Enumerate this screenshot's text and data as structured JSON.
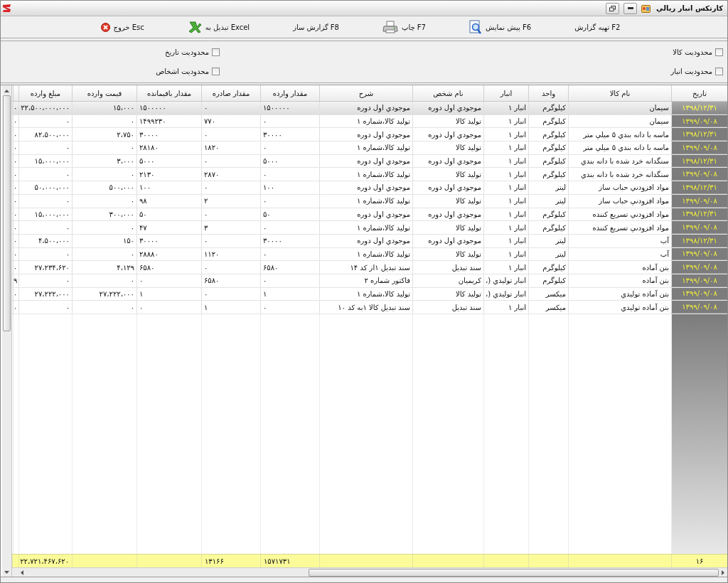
{
  "window": {
    "title": "کارتکس انبار ریالي"
  },
  "toolbar": [
    {
      "label": "تهیه گزارش  F2",
      "kind": "plain"
    },
    {
      "label": "پیش نمایش F6",
      "kind": "preview"
    },
    {
      "label": "چاپ F7",
      "kind": "print"
    },
    {
      "label": "گزارش ساز F8",
      "kind": "plain"
    },
    {
      "label": "تبدیل به Excel",
      "kind": "excel"
    },
    {
      "label": "خروج Esc",
      "kind": "exit"
    }
  ],
  "filters": [
    {
      "label": "محدودیت کالا",
      "checked": false
    },
    {
      "label": "محدودیت انبار",
      "checked": false
    },
    {
      "label": "محدودیت تاریخ",
      "checked": false
    },
    {
      "label": "محدودیت اشخاص",
      "checked": false
    }
  ],
  "table": {
    "columns": [
      "تاریخ",
      "نام کالا",
      "واحد",
      "انبار",
      "نام شخص",
      "شرح",
      "مقدار وارده",
      "مقدار صادره",
      "مقدار باقیمانده",
      "قیمت وارده",
      "مبلغ وارده"
    ],
    "rows": [
      {
        "selected": true,
        "cells": [
          "۱۳۹۸/۱۲/۳۱",
          "سیمان",
          "کیلوگرم",
          "انبار ۱",
          "موجودي اول دوره",
          "موجودي اول دوره",
          "۱۵۰۰۰۰۰",
          "۰",
          "۱۵۰۰۰۰۰",
          "۱۵،۰۰۰",
          "۲۲،۵۰۰،۰۰۰،۰۰۰",
          "۰"
        ]
      },
      {
        "selected": false,
        "cells": [
          "۱۳۹۹/۰۹/۰۸",
          "سیمان",
          "کیلوگرم",
          "انبار ۱",
          "تولید کالا",
          "تولید کالا،شماره ۱",
          "۰",
          "۷۷۰",
          "۱۴۹۹۲۳۰",
          "۰",
          "۰",
          "۰"
        ]
      },
      {
        "selected": false,
        "cells": [
          "۱۳۹۸/۱۲/۳۱",
          "ماسه با دانه بندي ۵ میلي متر",
          "کیلوگرم",
          "انبار ۱",
          "موجودي اول دوره",
          "موجودي اول دوره",
          "۳۰۰۰۰",
          "۰",
          "۳۰۰۰۰",
          "۲،۷۵۰",
          "۸۲،۵۰۰،۰۰۰",
          "۰"
        ]
      },
      {
        "selected": false,
        "cells": [
          "۱۳۹۹/۰۹/۰۸",
          "ماسه با دانه بندي ۵ میلي متر",
          "کیلوگرم",
          "انبار ۱",
          "تولید کالا",
          "تولید کالا،شماره ۱",
          "۰",
          "۱۸۲۰",
          "۲۸۱۸۰",
          "۰",
          "۰",
          "۰"
        ]
      },
      {
        "selected": false,
        "cells": [
          "۱۳۹۸/۱۲/۳۱",
          "سنگدانه خرد شده با دانه بندي",
          "کیلوگرم",
          "انبار ۱",
          "موجودي اول دوره",
          "موجودي اول دوره",
          "۵۰۰۰",
          "۰",
          "۵۰۰۰",
          "۳،۰۰۰",
          "۱۵،۰۰۰،۰۰۰",
          "۰"
        ]
      },
      {
        "selected": false,
        "cells": [
          "۱۳۹۹/۰۹/۰۸",
          "سنگدانه خرد شده با دانه بندي",
          "کیلوگرم",
          "انبار ۱",
          "تولید کالا",
          "تولید کالا،شماره ۱",
          "۰",
          "۲۸۷۰",
          "۲۱۳۰",
          "۰",
          "۰",
          "۰"
        ]
      },
      {
        "selected": false,
        "cells": [
          "۱۳۹۸/۱۲/۳۱",
          "مواد افزودني حباب ساز",
          "لیتر",
          "انبار ۱",
          "موجودي اول دوره",
          "موجودي اول دوره",
          "۱۰۰",
          "۰",
          "۱۰۰",
          "۵۰۰،۰۰۰",
          "۵۰،۰۰۰،۰۰۰",
          "۰"
        ]
      },
      {
        "selected": false,
        "cells": [
          "۱۳۹۹/۰۹/۰۸",
          "مواد افزودني حباب ساز",
          "لیتر",
          "انبار ۱",
          "تولید کالا",
          "تولید کالا،شماره ۱",
          "۰",
          "۲",
          "۹۸",
          "۰",
          "۰",
          "۰"
        ]
      },
      {
        "selected": false,
        "cells": [
          "۱۳۹۸/۱۲/۳۱",
          "مواد افزودني تسریع کننده",
          "کیلوگرم",
          "انبار ۱",
          "موجودي اول دوره",
          "موجودي اول دوره",
          "۵۰",
          "۰",
          "۵۰",
          "۳۰۰،۰۰۰",
          "۱۵،۰۰۰،۰۰۰",
          "۰"
        ]
      },
      {
        "selected": false,
        "cells": [
          "۱۳۹۹/۰۹/۰۸",
          "مواد افزودني تسریع کننده",
          "کیلوگرم",
          "انبار ۱",
          "تولید کالا",
          "تولید کالا،شماره ۱",
          "۰",
          "۳",
          "۴۷",
          "۰",
          "۰",
          "۰"
        ]
      },
      {
        "selected": false,
        "cells": [
          "۱۳۹۸/۱۲/۳۱",
          "آب",
          "لیتر",
          "انبار ۱",
          "موجودي اول دوره",
          "موجودي اول دوره",
          "۳۰۰۰۰",
          "۰",
          "۳۰۰۰۰",
          "۱۵۰",
          "۴،۵۰۰،۰۰۰",
          "۰"
        ]
      },
      {
        "selected": false,
        "cells": [
          "۱۳۹۹/۰۹/۰۸",
          "آب",
          "لیتر",
          "انبار ۱",
          "تولید کالا",
          "تولید کالا،شماره ۱",
          "۰",
          "۱۱۲۰",
          "۲۸۸۸۰",
          "۰",
          "۰",
          "۰"
        ]
      },
      {
        "selected": false,
        "cells": [
          "۱۳۹۹/۰۹/۰۸",
          "بتن آماده",
          "کیلوگرم",
          "انبار ۱",
          "سند تبدیل",
          "سند تبدیل ۱از کد ۱۴",
          "۶۵۸۰",
          "۰",
          "۶۵۸۰",
          "۴،۱۲۹",
          "۲۷،۲۳۴،۶۲۰",
          "۰"
        ]
      },
      {
        "selected": false,
        "cells": [
          "۱۳۹۹/۰۹/۰۸",
          "بتن آماده",
          "کیلوگرم",
          "انبار تولیدي (،",
          "کریمیان",
          "فاکتور شماره ۲",
          "۰",
          "۶۵۸۰",
          "۰",
          "۰",
          "۰",
          "۹"
        ]
      },
      {
        "selected": false,
        "cells": [
          "۱۳۹۹/۰۹/۰۸",
          "بتن آماده تولیدي",
          "میکسر",
          "انبار تولیدي (،",
          "تولید کالا",
          "تولید کالا،شماره ۱",
          "۱",
          "۰",
          "۱",
          "۲۷،۲۲۲،۰۰۰",
          "۲۷،۲۲۲،۰۰۰",
          "۰"
        ]
      },
      {
        "selected": false,
        "cells": [
          "۱۳۹۹/۰۹/۰۸",
          "بتن آماده تولیدي",
          "میکسر",
          "انبار ۱",
          "سند تبدیل",
          "سند تبدیل کالا ۱به کد ۱۰",
          "۰",
          "۱",
          "۰",
          "۰",
          "۰",
          "۰"
        ]
      }
    ],
    "footer": {
      "row_count": "۱۶",
      "incoming_quantity": "۱۵۷۱۷۳۱",
      "outgoing_quantity": "۱۳۱۶۶",
      "incoming_amount": "۲۲،۷۲۱،۴۶۷،۶۲۰"
    }
  }
}
